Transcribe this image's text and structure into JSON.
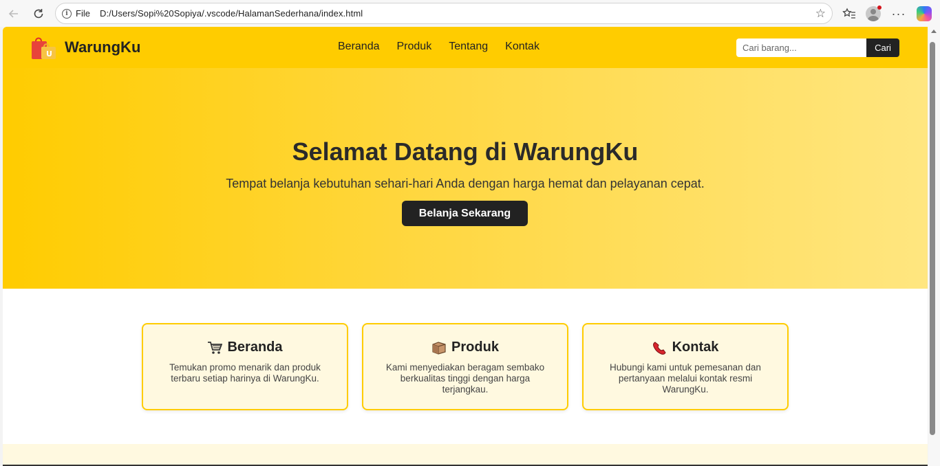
{
  "browser": {
    "file_label": "File",
    "url": "D:/Users/Sopi%20Sopiya/.vscode/HalamanSederhana/index.html"
  },
  "site": {
    "brand": "WarungKu",
    "nav": [
      "Beranda",
      "Produk",
      "Tentang",
      "Kontak"
    ],
    "search": {
      "placeholder": "Cari barang...",
      "button": "Cari"
    }
  },
  "hero": {
    "title": "Selamat Datang di WarungKu",
    "subtitle": "Tempat belanja kebutuhan sehari-hari Anda dengan harga hemat dan pelayanan cepat.",
    "button": "Belanja Sekarang"
  },
  "features": [
    {
      "icon": "shopping-cart-icon",
      "title": "Beranda",
      "text": "Temukan promo menarik dan produk terbaru setiap harinya di WarungKu."
    },
    {
      "icon": "package-box-icon",
      "title": "Produk",
      "text": "Kami menyediakan beragam sembako berkualitas tinggi dengan harga terjangkau."
    },
    {
      "icon": "telephone-icon",
      "title": "Kontak",
      "text": "Hubungi kami untuk pemesanan dan pertanyaan melalui kontak resmi WarungKu."
    }
  ],
  "colors": {
    "primary": "#ffcc00",
    "dark": "#222222",
    "card_bg": "#fff9e0"
  }
}
